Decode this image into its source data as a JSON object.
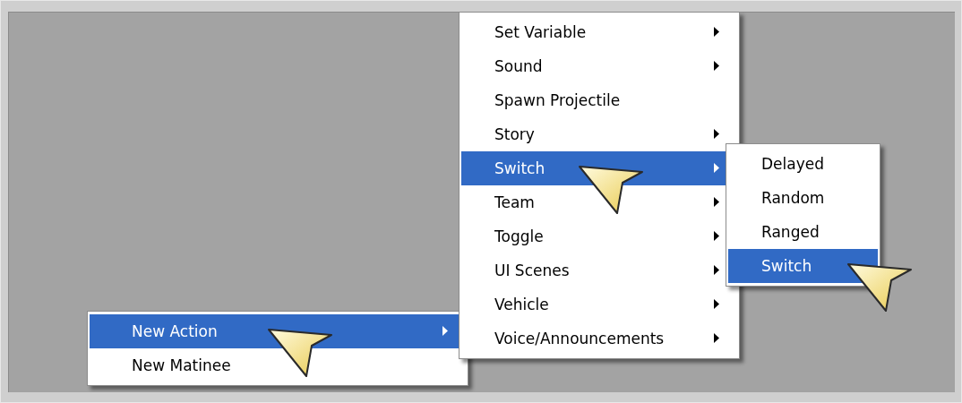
{
  "menus": [
    {
      "items": [
        {
          "label": "New Action",
          "selected": true,
          "has_submenu": true
        },
        {
          "label": "New Matinee",
          "selected": false,
          "has_submenu": false
        }
      ]
    },
    {
      "items": [
        {
          "label": "Set Variable",
          "selected": false,
          "has_submenu": true
        },
        {
          "label": "Sound",
          "selected": false,
          "has_submenu": true
        },
        {
          "label": "Spawn Projectile",
          "selected": false,
          "has_submenu": false
        },
        {
          "label": "Story",
          "selected": false,
          "has_submenu": true
        },
        {
          "label": "Switch",
          "selected": true,
          "has_submenu": true
        },
        {
          "label": "Team",
          "selected": false,
          "has_submenu": true
        },
        {
          "label": "Toggle",
          "selected": false,
          "has_submenu": true
        },
        {
          "label": "UI Scenes",
          "selected": false,
          "has_submenu": true
        },
        {
          "label": "Vehicle",
          "selected": false,
          "has_submenu": true
        },
        {
          "label": "Voice/Announcements",
          "selected": false,
          "has_submenu": true
        }
      ]
    },
    {
      "items": [
        {
          "label": "Delayed",
          "selected": false,
          "has_submenu": false
        },
        {
          "label": "Random",
          "selected": false,
          "has_submenu": false
        },
        {
          "label": "Ranged",
          "selected": false,
          "has_submenu": false
        },
        {
          "label": "Switch",
          "selected": true,
          "has_submenu": false
        }
      ]
    }
  ]
}
